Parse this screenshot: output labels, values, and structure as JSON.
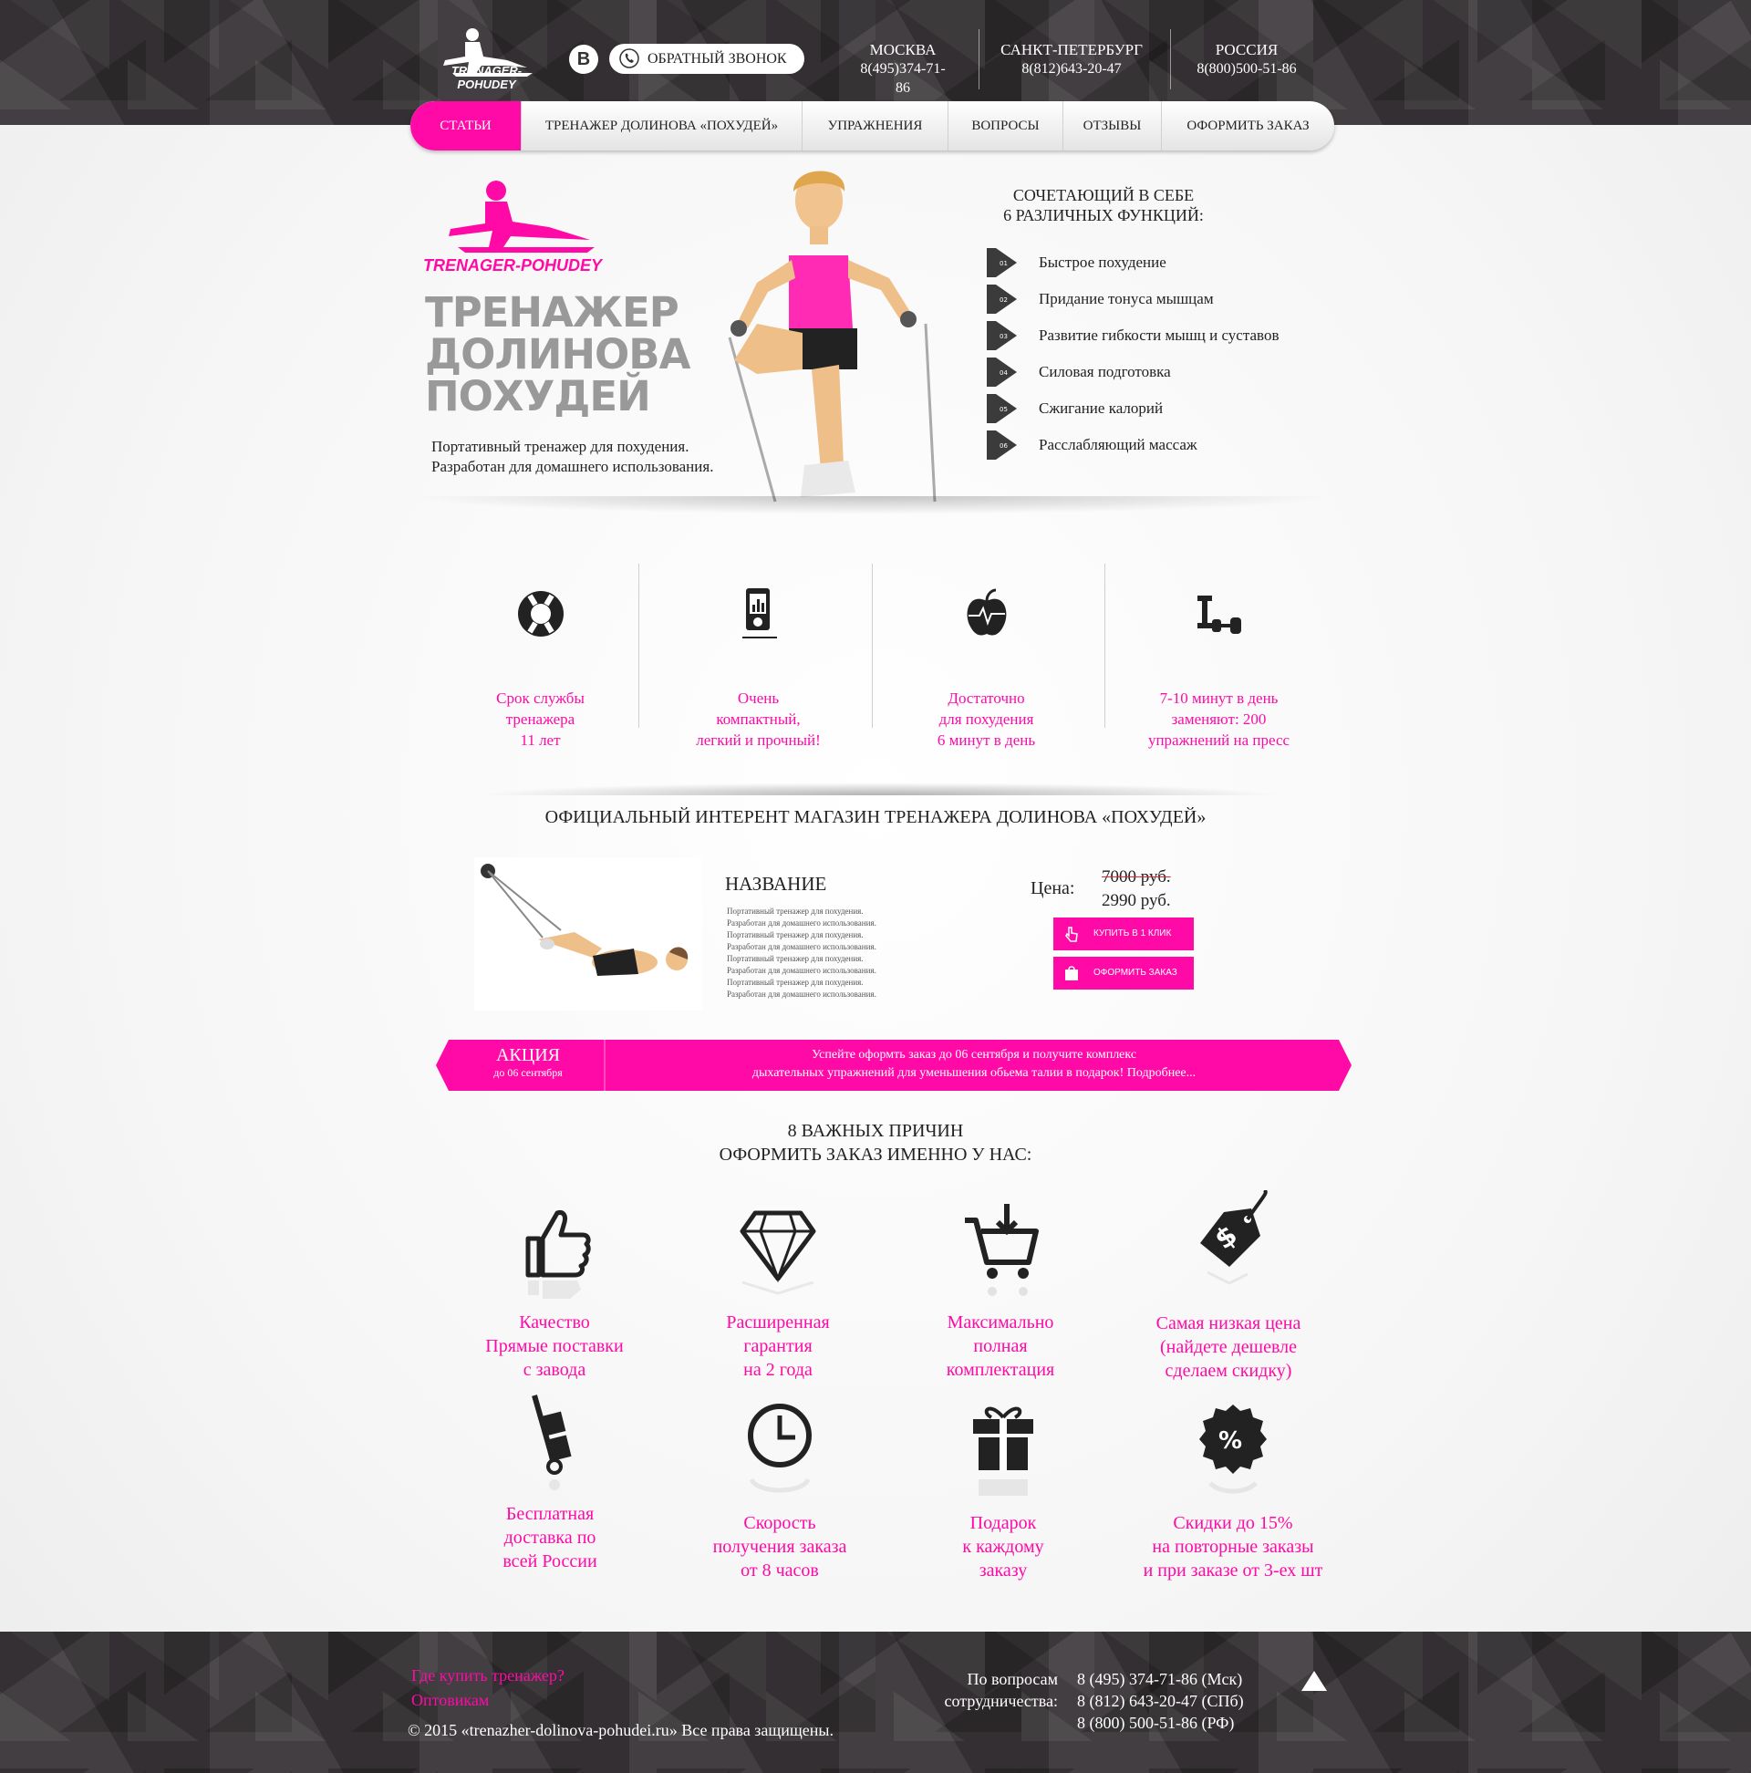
{
  "header": {
    "logo_text": "TRENAGER-POHUDEY",
    "vk_label": "В",
    "callback_label": "ОБРАТНЫЙ ЗВОНОК",
    "cities": [
      {
        "name": "МОСКВА",
        "phone": "8(495)374-71-86"
      },
      {
        "name": "САНКТ-ПЕТЕРБУРГ",
        "phone": "8(812)643-20-47"
      },
      {
        "name": "РОССИЯ",
        "phone": "8(800)500-51-86"
      }
    ]
  },
  "nav": {
    "items": [
      {
        "label": "СТАТЬИ",
        "active": true
      },
      {
        "label": "ТРЕНАЖЕР ДОЛИНОВА «ПОХУДЕЙ»"
      },
      {
        "label": "УПРАЖНЕНИЯ"
      },
      {
        "label": "ВОПРОСЫ"
      },
      {
        "label": "ОТЗЫВЫ"
      },
      {
        "label": "ОФОРМИТЬ ЗАКАЗ"
      }
    ]
  },
  "hero": {
    "logo_text": "TRENAGER-POHUDEY",
    "title_lines": [
      "ТРЕНАЖЕР",
      "ДОЛИНОВА",
      "ПОХУДЕЙ"
    ],
    "desc_lines": [
      "Портативный тренажер для похудения.",
      "Разработан для домашнего использования."
    ],
    "features_title_lines": [
      "СОЧЕТАЮЩИЙ В СЕБЕ",
      "6 РАЗЛИЧНЫХ ФУНКЦИЙ:"
    ],
    "features": [
      {
        "num": "01",
        "label": "Быстрое похудение"
      },
      {
        "num": "02",
        "label": "Придание тонуса мышцам"
      },
      {
        "num": "03",
        "label": "Развитие гибкости мышц и суставов"
      },
      {
        "num": "04",
        "label": "Силовая подготовка"
      },
      {
        "num": "05",
        "label": "Сжигание калорий"
      },
      {
        "num": "06",
        "label": "Расслабляющий массаж"
      }
    ]
  },
  "benefits": [
    {
      "icon": "lifebuoy-icon",
      "lines": [
        "Срок службы",
        "тренажера",
        "11 лет"
      ]
    },
    {
      "icon": "mp3-player-icon",
      "lines": [
        "Очень",
        "компактный,",
        "легкий и прочный!"
      ]
    },
    {
      "icon": "apple-pulse-icon",
      "lines": [
        "Достаточно",
        "для похудения",
        "6 минут в день"
      ]
    },
    {
      "icon": "dumbbells-icon",
      "lines": [
        "7-10 минут в день",
        "заменяют: 200",
        "упражнений на пресс"
      ]
    }
  ],
  "shop": {
    "title": "ОФИЦИАЛЬНЫЙ ИНТЕРЕНТ МАГАЗИН ТРЕНАЖЕРА ДОЛИНОВА «ПОХУДЕЙ»",
    "product": {
      "name": "НАЗВАНИЕ",
      "desc_lines": [
        "Портативный тренажер для похудения.",
        "Разработан для домашнего использования.",
        "Портативный тренажер для похудения.",
        "Разработан для домашнего использования.",
        "Портативный тренажер для похудения.",
        "Разработан для домашнего использования.",
        "Портативный тренажер для похудения.",
        "Разработан для домашнего использования."
      ],
      "price_label": "Цена:",
      "old_price": "7000 руб.",
      "new_price": "2990 руб.",
      "buy_one_click": "КУПИТЬ В 1 КЛИК",
      "order_label": "ОФОРМИТЬ ЗАКАЗ"
    }
  },
  "promo": {
    "title": "АКЦИЯ",
    "date": "до 06 сентября",
    "text_lines": [
      "Успейте оформть заказ до 06 сентября и получите комплекс",
      "дыхательных упражнений для уменьшения обьема талии в подарок! Подробнее..."
    ]
  },
  "reasons": {
    "title_lines": [
      "8 ВАЖНЫХ ПРИЧИН",
      "ОФОРМИТЬ ЗАКАЗ ИМЕННО У НАС:"
    ],
    "items": [
      {
        "icon": "thumbs-up-icon",
        "lines": [
          "Качество",
          "Прямые поставки",
          "с завода"
        ]
      },
      {
        "icon": "diamond-icon",
        "lines": [
          "Расширенная",
          "гарантия",
          "на 2 года"
        ]
      },
      {
        "icon": "cart-icon",
        "lines": [
          "Максимально",
          "полная",
          "комплектация"
        ]
      },
      {
        "icon": "price-tag-icon",
        "lines": [
          "Самая низкая цена",
          "(найдете дешевле",
          "сделаем скидку)"
        ]
      },
      {
        "icon": "hand-truck-icon",
        "lines": [
          "Бесплатная",
          "доставка по",
          "всей России"
        ]
      },
      {
        "icon": "clock-icon",
        "lines": [
          "Скорость",
          "получения заказа",
          "от 8 часов"
        ]
      },
      {
        "icon": "gift-icon",
        "lines": [
          "Подарок",
          "к каждому",
          "заказу"
        ]
      },
      {
        "icon": "discount-badge-icon",
        "lines": [
          "Скидки до 15%",
          "на повторные заказы",
          "и при заказе от 3-ех шт"
        ]
      }
    ]
  },
  "footer": {
    "links": [
      "Где купить тренажер?",
      "Оптовикам"
    ],
    "copyright": "© 2015 «trenazher-dolinova-pohudei.ru» Все права защищены.",
    "questions_lines": [
      "По вопросам",
      "сотрудничества:"
    ],
    "phones": [
      "8 (495) 374-71-86 (Мск)",
      "8 (812) 643-20-47 (СПб)",
      "8 (800) 500-51-86 (РФ)"
    ]
  },
  "colors": {
    "accent": "#ff0aa7",
    "dark": "#3a3639"
  }
}
